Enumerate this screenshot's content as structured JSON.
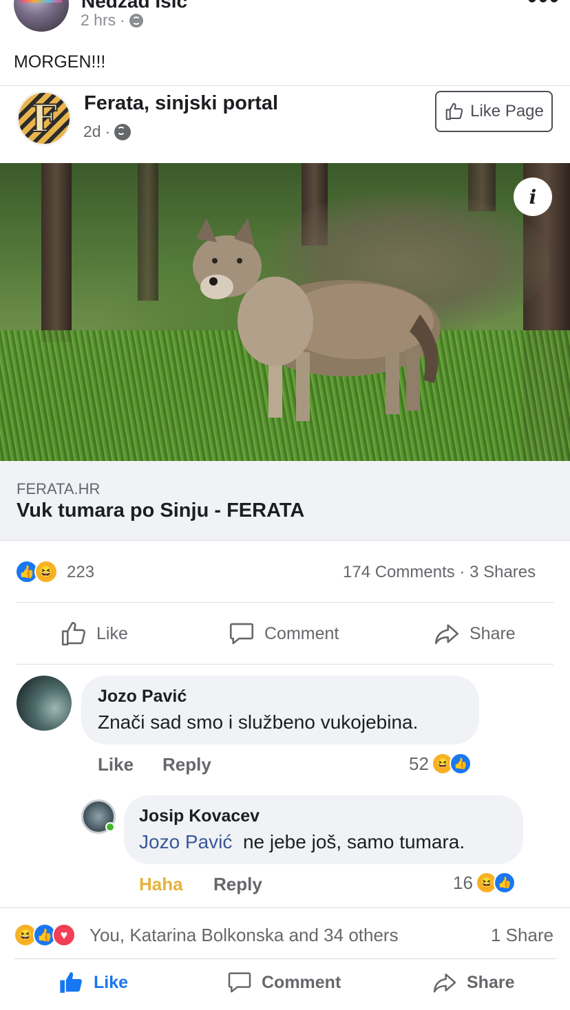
{
  "post": {
    "author": "Nedžad Išić",
    "time": "2 hrs",
    "separator": "·",
    "text": "MORGEN!!!",
    "menu": "•••"
  },
  "shared": {
    "page_name": "Ferata, sinjski portal",
    "logo_letter": "F",
    "time": "2d",
    "separator": "·",
    "like_page_label": "Like Page",
    "photo_info_icon": "i",
    "link_domain": "FERATA.HR",
    "link_title": "Vuk tumara po Sinju - FERATA",
    "reaction_count": "223",
    "comments_shares": "174 Comments · 3 Shares",
    "actions": {
      "like": "Like",
      "comment": "Comment",
      "share": "Share"
    }
  },
  "comments": [
    {
      "author": "Jozo Pavić",
      "text": "Znači sad smo i službeno vukojebina.",
      "like_label": "Like",
      "reply_label": "Reply",
      "reaction_count": "52"
    },
    {
      "author": "Josip Kovacev",
      "mention": "Jozo Pavić",
      "text": "ne jebe još, samo tumara.",
      "like_label": "Haha",
      "reply_label": "Reply",
      "reaction_count": "16"
    }
  ],
  "footer": {
    "reactions_text": "You, Katarina Bolkonska and 34 others",
    "share_count": "1 Share",
    "actions": {
      "like": "Like",
      "comment": "Comment",
      "share": "Share"
    }
  },
  "colors": {
    "accent": "#1877f2",
    "haha": "#f7b125",
    "love": "#f33e58",
    "mention": "#385898",
    "muted": "#65676b"
  },
  "icons": [
    "globe-icon",
    "thumbs-up-icon",
    "comment-icon",
    "share-icon",
    "info-icon",
    "like-reaction-icon",
    "haha-reaction-icon",
    "love-reaction-icon"
  ]
}
